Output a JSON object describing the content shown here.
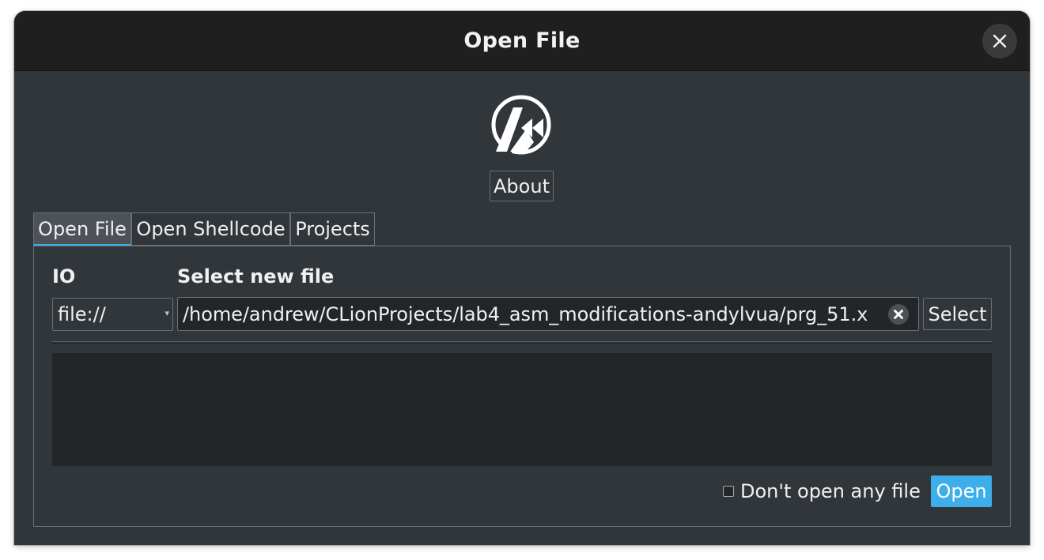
{
  "window": {
    "title": "Open File",
    "close_icon": "close-icon"
  },
  "header": {
    "logo_icon": "cutter-logo-icon",
    "about_label": "About"
  },
  "tabs": [
    {
      "label": "Open File",
      "active": true
    },
    {
      "label": "Open Shellcode",
      "active": false
    },
    {
      "label": "Projects",
      "active": false
    }
  ],
  "open_file": {
    "io_label": "IO",
    "file_label": "Select new file",
    "io_value": "file://",
    "path_value": "/home/andrew/CLionProjects/lab4_asm_modifications-andylvua/prg_51.x",
    "clear_icon": "clear-icon",
    "select_label": "Select",
    "dont_open_label": "Don't open any file",
    "dont_open_checked": false,
    "open_label": "Open"
  },
  "colors": {
    "accent": "#3daee9",
    "background": "#31363b",
    "titlebar": "#1f1f1f"
  }
}
